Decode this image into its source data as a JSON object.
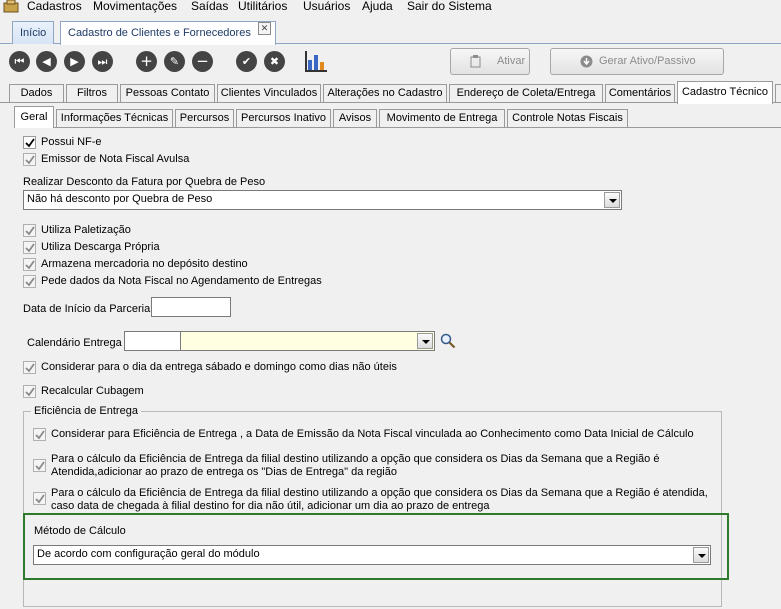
{
  "menu": {
    "items": [
      "Cadastros",
      "Movimentações",
      "Saídas",
      "Utilitários",
      "Usuários",
      "Ajuda",
      "Sair do Sistema"
    ]
  },
  "doc_tabs": {
    "home": "Início",
    "active": "Cadastro de Clientes e Fornecedores"
  },
  "toolbar": {
    "icons": [
      "first-icon",
      "previous-icon",
      "next-icon",
      "last-icon",
      "add-icon",
      "edit-icon",
      "remove-icon",
      "confirm-icon",
      "cancel-icon",
      "chart-icon"
    ],
    "ativar_label": "Ativar",
    "gerar_label": "Gerar Ativo/Passivo"
  },
  "main_tabs": [
    "Dados",
    "Filtros",
    "Pessoas Contato",
    "Clientes Vinculados",
    "Alterações no Cadastro",
    "Endereço de Coleta/Entrega",
    "Comentários",
    "Cadastro Técnico"
  ],
  "main_tab_active": "Cadastro Técnico",
  "sub_tabs": [
    "Geral",
    "Informações Técnicas",
    "Percursos",
    "Percursos Inativo",
    "Avisos",
    "Movimento de Entrega",
    "Controle Notas Fiscais"
  ],
  "sub_tab_active": "Geral",
  "form": {
    "possui_nfe": "Possui NF-e",
    "emissor_avulsa": "Emissor de Nota Fiscal Avulsa",
    "desconto_label": "Realizar Desconto da Fatura por Quebra de Peso",
    "desconto_value": "Não há desconto por Quebra de Peso",
    "utiliza_paletizacao": "Utiliza Paletização",
    "utiliza_descarga": "Utiliza Descarga Própria",
    "armazena": "Armazena mercadoria no depósito destino",
    "pede_dados": "Pede dados da Nota Fiscal no Agendamento de Entregas",
    "data_inicio_label": "Data de Início da Parceria",
    "data_inicio_value": "",
    "calendario_label": "Calendário Entrega",
    "calendario_code": "",
    "calendario_desc": "",
    "considerar_sabado": "Considerar para o dia da entrega sábado e domingo como dias não úteis",
    "recalcular": "Recalcular Cubagem"
  },
  "eficiencia": {
    "title": "Eficiência de Entrega",
    "opt1": "Considerar para Eficiência de Entrega , a Data de Emissão da Nota Fiscal vinculada ao Conhecimento como Data Inicial de Cálculo",
    "opt2_line1": "Para o cálculo da Eficiência de Entrega da filial destino utilizando a opção que considera os Dias da Semana que a Região é",
    "opt2_line2": "Atendida,adicionar ao prazo de entrega os \"Dias de Entrega\" da região",
    "opt3_line1": "Para o cálculo da Eficiência de Entrega da filial destino utilizando a opção que considera os Dias da Semana que a Região é atendida,",
    "opt3_line2": "caso data de chegada à filial destino for dia não útil, adicionar um dia ao prazo de entrega",
    "metodo_label": "Método de Cálculo",
    "metodo_value": "De acordo com configuração geral do módulo"
  },
  "checked": {
    "possui_nfe": true,
    "emissor_avulsa": true,
    "utiliza_paletizacao": true,
    "utiliza_descarga": true,
    "armazena": true,
    "pede_dados": true,
    "considerar_sabado": true,
    "recalcular": true,
    "opt1": true,
    "opt2": true,
    "opt3": true
  },
  "colors": {
    "highlight_border": "#2d7a2d",
    "calendar_field_bg": "#ffffe1"
  }
}
